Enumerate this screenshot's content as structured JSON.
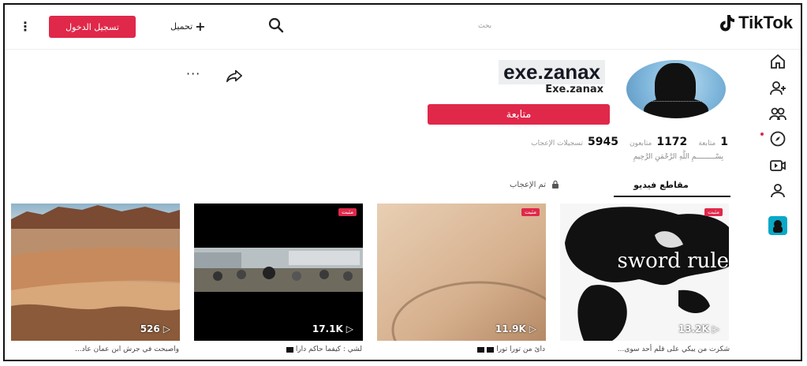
{
  "header": {
    "more_icon": "vertical-ellipsis",
    "login_label": "تسجيل الدخول",
    "upload_label": "تحميل",
    "search_placeholder": "بحث",
    "logo_text": "TikTok"
  },
  "sidebar": {
    "items": [
      {
        "name": "home",
        "icon": "home-icon"
      },
      {
        "name": "following",
        "icon": "person-add-icon"
      },
      {
        "name": "friends",
        "icon": "friends-icon"
      },
      {
        "name": "explore",
        "icon": "compass-icon"
      },
      {
        "name": "live",
        "icon": "live-camera-icon"
      },
      {
        "name": "profile",
        "icon": "person-icon"
      },
      {
        "name": "avatar",
        "icon": "user-avatar-icon"
      }
    ]
  },
  "profile": {
    "username": "exe.zanax",
    "nickname": "Exe.zanax",
    "follow_label": "متابعة",
    "stats": [
      {
        "value": "1",
        "label": "متابعة"
      },
      {
        "value": "1172",
        "label": "متابعون"
      },
      {
        "value": "5945",
        "label": "تسجيلات الإعجاب"
      }
    ],
    "bio": "بِسْـــــــــمِ اللَّهِ الرَّحْمَنِ الرَّحِيمِ"
  },
  "tabs": {
    "videos_label": "مقاطع فيديو",
    "liked_label": "تم الإعجاب"
  },
  "videos": [
    {
      "views": "13.2K",
      "pinned_label": "مثبت",
      "overlay_text": "sword rule",
      "caption": "شكرت من يبكي على قلم أحد سوى..."
    },
    {
      "views": "11.9K",
      "pinned_label": "مثبت",
      "caption": "دائ من تورا تورا"
    },
    {
      "views": "17.1K",
      "pinned_label": "مثبت",
      "caption": "لشي : كيفما حاكم دارا"
    },
    {
      "views": "526",
      "caption": "واصبحت في جرش ابن عمان عاد..."
    }
  ],
  "colors": {
    "accent": "#e0284a",
    "text": "#161823"
  }
}
